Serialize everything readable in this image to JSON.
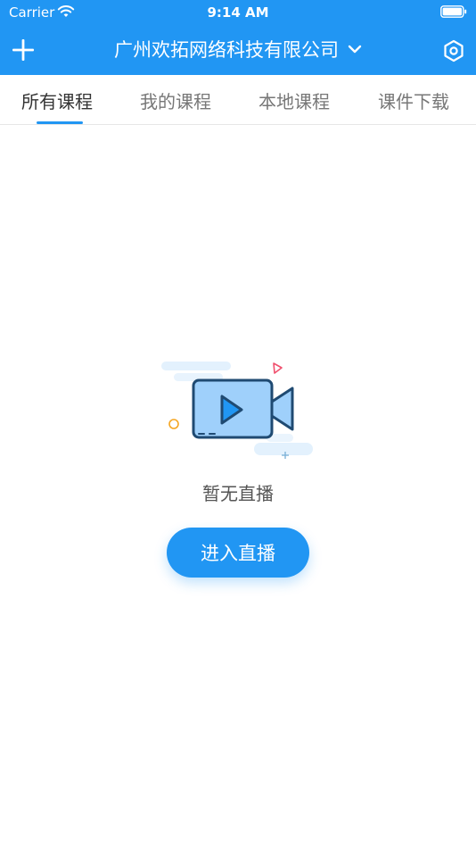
{
  "status_bar": {
    "carrier": "Carrier",
    "time": "9:14 AM",
    "wifi_icon": "wifi-icon",
    "battery_icon": "battery-icon"
  },
  "header": {
    "title": "广州欢拓网络科技有限公司",
    "add_icon": "plus-icon",
    "dropdown_icon": "chevron-down-icon",
    "settings_icon": "hexagon-settings-icon",
    "background_color": "#2196f3"
  },
  "tabs": [
    {
      "label": "所有课程",
      "active": true
    },
    {
      "label": "我的课程",
      "active": false
    },
    {
      "label": "本地课程",
      "active": false
    },
    {
      "label": "课件下载",
      "active": false
    }
  ],
  "empty_state": {
    "illustration_icon": "video-camera-icon",
    "message": "暂无直播",
    "button_label": "进入直播"
  },
  "colors": {
    "accent": "#2196f3",
    "tab_active": "#333333",
    "tab_inactive": "#777777"
  }
}
